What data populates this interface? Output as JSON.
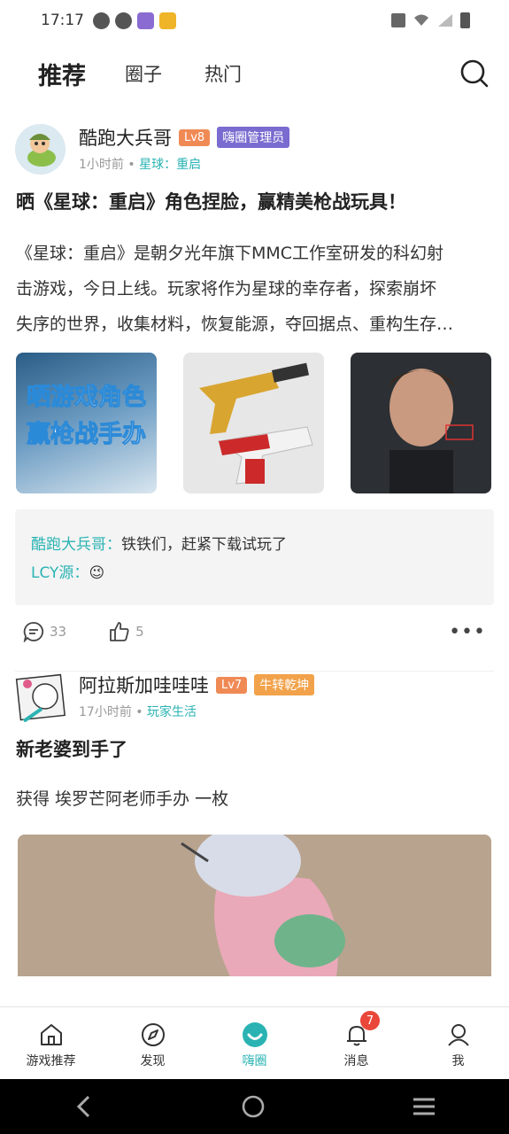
{
  "status": {
    "time": "17:17"
  },
  "tabs": [
    {
      "label": "推荐"
    },
    {
      "label": "圈子"
    },
    {
      "label": "热门"
    }
  ],
  "posts": [
    {
      "user": "酷跑大兵哥",
      "level": "Lv8",
      "role": "嗨圈管理员",
      "time": "1小时前",
      "dot": "•",
      "topic": "星球：重启",
      "title": "晒《星球：重启》角色捏脸，赢精美枪战玩具！",
      "body_lines": [
        "《星球：重启》是朝夕光年旗下MMC工作室研发的科幻射",
        "击游戏，今日上线。玩家将作为星球的幸存者，探索崩坏",
        "失序的世界，收集材料，恢复能源，夺回据点、重构生存…"
      ],
      "thumb1_text": [
        "晒游戏角色",
        "赢枪战手办"
      ],
      "comments": [
        {
          "name": "酷跑大兵哥：",
          "text": "铁铁们，赶紧下载试玩了"
        },
        {
          "name": "LCY源：",
          "text": "😉"
        }
      ],
      "comment_count": "33",
      "like_count": "5",
      "more": "•••"
    },
    {
      "user": "阿拉斯加哇哇哇",
      "level": "Lv7",
      "role": "牛转乾坤",
      "time": "17小时前",
      "dot": "•",
      "topic": "玩家生活",
      "title": "新老婆到手了",
      "body": "获得 埃罗芒阿老师手办 一枚"
    }
  ],
  "bottom_nav": [
    {
      "label": "游戏推荐",
      "icon": "home-icon"
    },
    {
      "label": "发现",
      "icon": "compass-icon"
    },
    {
      "label": "嗨圈",
      "icon": "hiquan-icon"
    },
    {
      "label": "消息",
      "icon": "bell-icon",
      "badge": "7"
    },
    {
      "label": "我",
      "icon": "user-icon"
    }
  ],
  "colors": {
    "accent": "#2bb3b3",
    "badge_lv": "#f08a55",
    "role1": "#7a6bd0",
    "role2": "#f2a24a",
    "notify": "#e9473a"
  }
}
